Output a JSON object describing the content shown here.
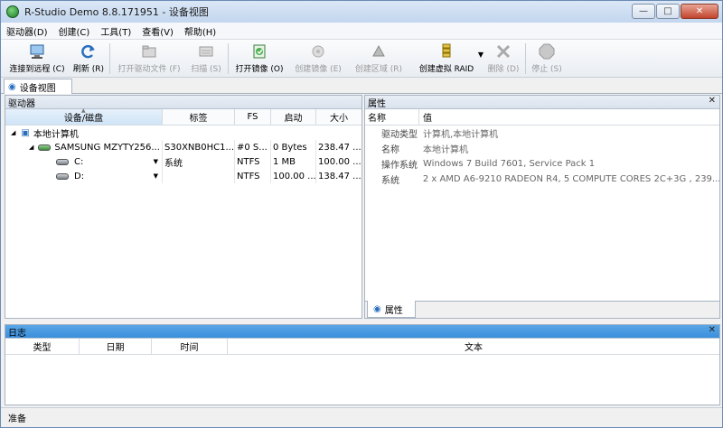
{
  "window": {
    "title": "R-Studio Demo 8.8.171951 - 设备视图",
    "controls": {
      "minimize": "—",
      "maximize": "□",
      "close": "✕"
    }
  },
  "menu": [
    "驱动器(D)",
    "创建(C)",
    "工具(T)",
    "查看(V)",
    "帮助(H)"
  ],
  "toolbar": {
    "connect_remote": "连接到远程 (C)",
    "refresh": "刷新 (R)",
    "open_drive_files": "打开驱动文件 (F)",
    "scan": "扫描 (S)",
    "open_image": "打开镜像 (O)",
    "create_image": "创建镜像 (E)",
    "create_region": "创建区域 (R)",
    "create_virtual_raid": "创建虚拟 RAID",
    "delete": "删除 (D)",
    "stop": "停止 (S)"
  },
  "tabs": {
    "device_view": "设备视图"
  },
  "drives_panel": {
    "title": "驱动器",
    "columns": [
      "设备/磁盘",
      "标签",
      "FS",
      "启动",
      "大小"
    ],
    "rows": [
      {
        "device": "本地计算机",
        "label": "",
        "fs": "",
        "start": "",
        "size": ""
      },
      {
        "device": "SAMSUNG MZYTY256...",
        "label": "S30XNB0HC1...",
        "fs": "#0 S...",
        "start": "0 Bytes",
        "size": "238.47 ..."
      },
      {
        "device": "C:",
        "label": "系统",
        "fs": "NTFS",
        "start": "1 MB",
        "size": "100.00 ..."
      },
      {
        "device": "D:",
        "label": "",
        "fs": "NTFS",
        "start": "100.00 ...",
        "size": "138.47 ..."
      }
    ]
  },
  "properties_panel": {
    "title": "属性",
    "columns": [
      "名称",
      "值"
    ],
    "rows": [
      {
        "name": "驱动类型",
        "value": "计算机,本地计算机"
      },
      {
        "name": "名称",
        "value": "本地计算机"
      },
      {
        "name": "操作系统",
        "value": "Windows 7 Build 7601, Service Pack 1"
      },
      {
        "name": "系统",
        "value": "2 x AMD A6-9210 RADEON R4, 5 COMPUTE CORES 2C+3G   , 239..."
      }
    ],
    "bottom_tab": "属性"
  },
  "log_panel": {
    "title": "日志",
    "columns": [
      "类型",
      "日期",
      "时间",
      "文本"
    ]
  },
  "status": {
    "text": "准备"
  },
  "colors": {
    "accent": "#3a8fdc",
    "panel_border": "#a9b4c2"
  }
}
